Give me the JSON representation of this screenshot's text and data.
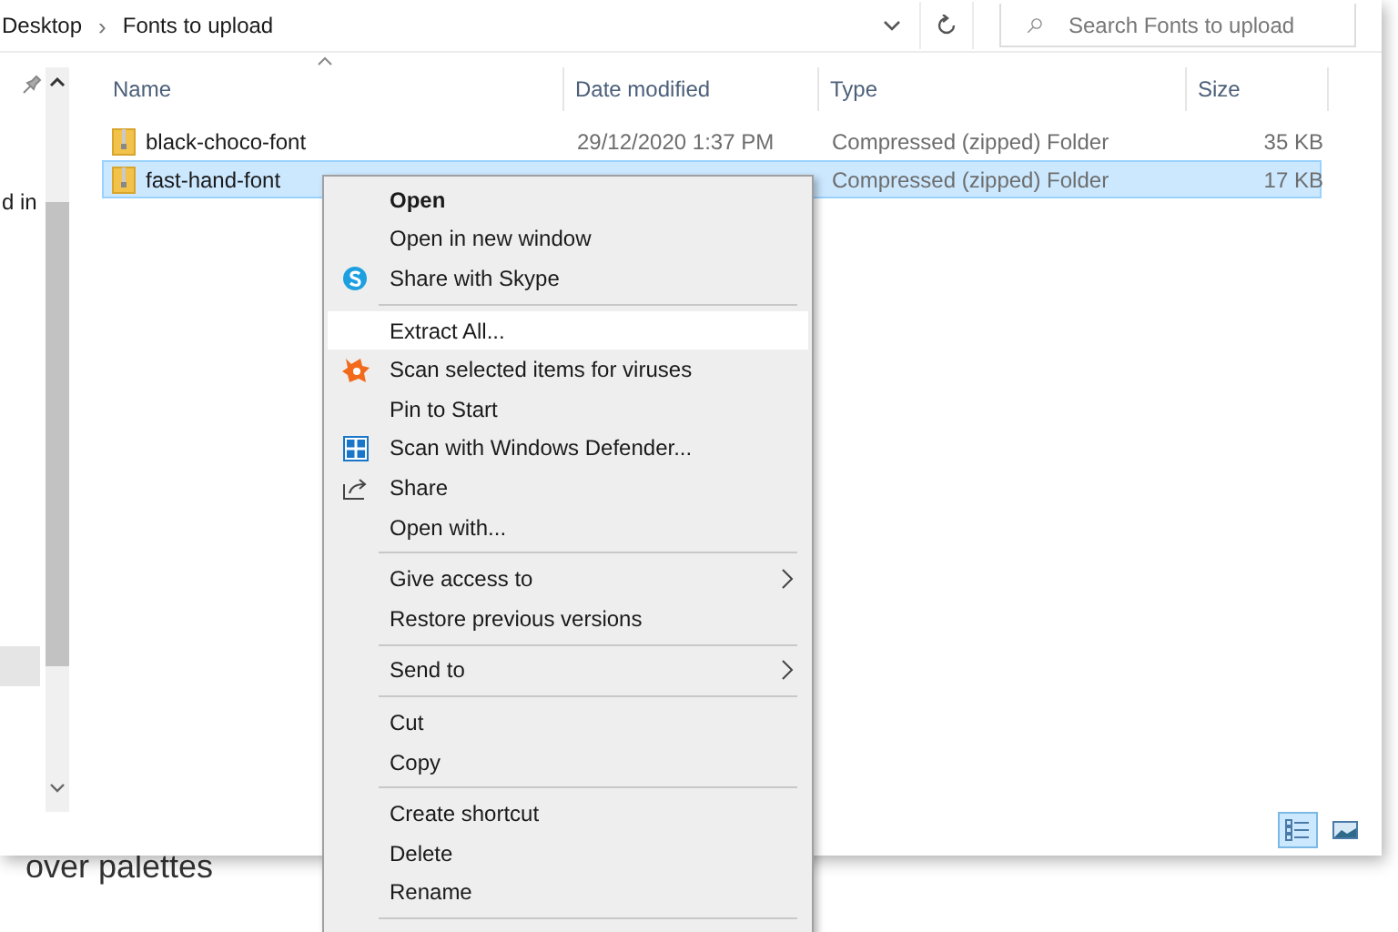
{
  "background_page": {
    "texts": [
      "over palettes"
    ]
  },
  "address_bar": {
    "breadcrumbs": [
      "Desktop",
      "Fonts to upload"
    ],
    "separator": "›"
  },
  "search": {
    "placeholder": "Search Fonts to upload"
  },
  "nav_pane": {
    "items": [
      "d in"
    ]
  },
  "columns": [
    {
      "label": "Name",
      "sorted": true
    },
    {
      "label": "Date modified",
      "sorted": false
    },
    {
      "label": "Type",
      "sorted": false
    },
    {
      "label": "Size",
      "sorted": false
    }
  ],
  "files": [
    {
      "name": "black-choco-font",
      "date": "29/12/2020 1:37 PM",
      "type": "Compressed (zipped) Folder",
      "size": "35 KB",
      "selected": false
    },
    {
      "name": "fast-hand-font",
      "type": "Compressed (zipped) Folder",
      "size": "17 KB",
      "selected": true
    }
  ],
  "view_buttons": [
    {
      "kind": "details",
      "selected": true
    },
    {
      "kind": "large-icons",
      "selected": false
    }
  ],
  "context_menu": {
    "items": [
      {
        "kind": "item",
        "label": "Open",
        "default": true,
        "highlighted": false
      },
      {
        "kind": "item",
        "label": "Open in new window",
        "default": false,
        "highlighted": false
      },
      {
        "kind": "skype",
        "label": "Share with Skype",
        "default": false,
        "highlighted": false
      },
      {
        "kind": "separator"
      },
      {
        "kind": "item",
        "label": "Extract All...",
        "default": false,
        "highlighted": true
      },
      {
        "kind": "antivirus",
        "label": "Scan selected items for viruses",
        "default": false,
        "highlighted": false
      },
      {
        "kind": "item",
        "label": "Pin to Start",
        "default": false,
        "highlighted": false
      },
      {
        "kind": "defender",
        "label": "Scan with Windows Defender...",
        "default": false,
        "highlighted": false
      },
      {
        "kind": "share",
        "label": "Share",
        "default": false,
        "highlighted": false
      },
      {
        "kind": "item",
        "label": "Open with...",
        "default": false,
        "highlighted": false
      },
      {
        "kind": "separator"
      },
      {
        "kind": "item",
        "label": "Give access to",
        "submenu": true,
        "default": false,
        "highlighted": false
      },
      {
        "kind": "item",
        "label": "Restore previous versions",
        "default": false,
        "highlighted": false
      },
      {
        "kind": "separator"
      },
      {
        "kind": "item",
        "label": "Send to",
        "submenu": true,
        "default": false,
        "highlighted": false
      },
      {
        "kind": "separator"
      },
      {
        "kind": "item",
        "label": "Cut",
        "default": false,
        "highlighted": false
      },
      {
        "kind": "item",
        "label": "Copy",
        "default": false,
        "highlighted": false
      },
      {
        "kind": "separator"
      },
      {
        "kind": "item",
        "label": "Create shortcut",
        "default": false,
        "highlighted": false
      },
      {
        "kind": "item",
        "label": "Delete",
        "default": false,
        "highlighted": false
      },
      {
        "kind": "item",
        "label": "Rename",
        "default": false,
        "highlighted": false
      },
      {
        "kind": "separator"
      }
    ]
  }
}
